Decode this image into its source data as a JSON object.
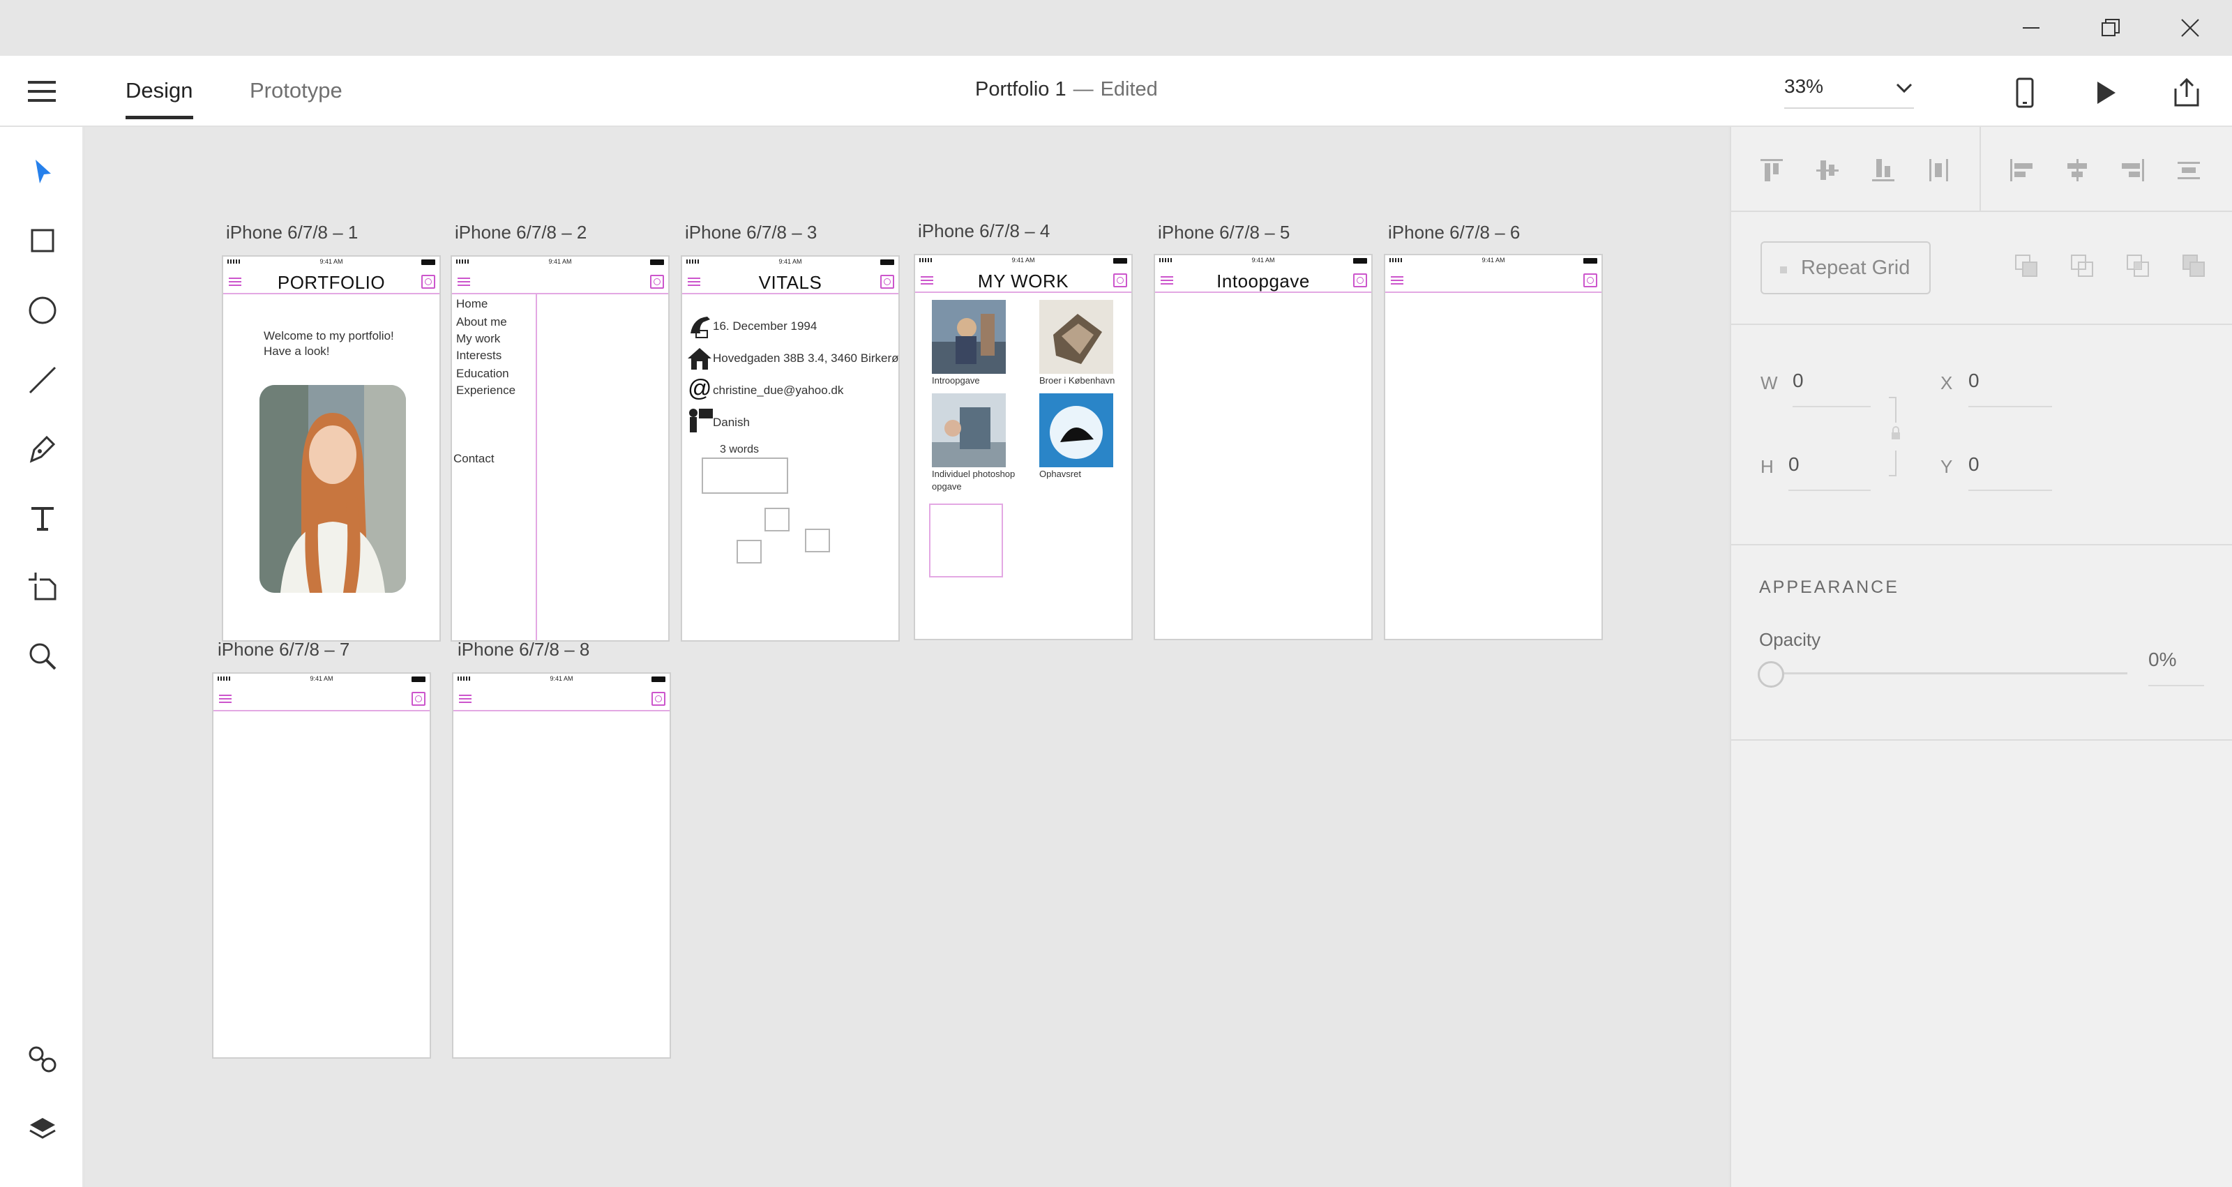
{
  "header": {
    "tabs": [
      "Design",
      "Prototype"
    ],
    "doc_name": "Portfolio 1",
    "doc_separator": "—",
    "doc_status": "Edited",
    "zoom": "33%"
  },
  "tools": [
    "select-icon",
    "rectangle-icon",
    "ellipse-icon",
    "line-icon",
    "pen-icon",
    "text-icon",
    "artboard-icon",
    "zoom-icon",
    "symbols-icon",
    "layers-icon"
  ],
  "artboards": {
    "a1": {
      "label": "iPhone 6/7/8 – 1",
      "title": "PORTFOLIO",
      "welcome1": "Welcome to my portfolio!",
      "welcome2": "Have a look!"
    },
    "a2": {
      "label": "iPhone 6/7/8 – 2",
      "menu": [
        "Home",
        "About me",
        "My work",
        "Interests",
        "Education",
        "Experience"
      ],
      "contact": "Contact"
    },
    "a3": {
      "label": "iPhone 6/7/8 – 3",
      "title": "VITALS",
      "birth": "16. December 1994",
      "address": "Hovedgaden 38B 3.4, 3460 Birkerød",
      "email": "christine_due@yahoo.dk",
      "language": "Danish",
      "words": "3 words"
    },
    "a4": {
      "label": "iPhone 6/7/8 – 4",
      "title": "MY WORK",
      "items": [
        "Introopgave",
        "Broer i København",
        "Individuel photoshop",
        "opgave",
        "Ophavsret"
      ]
    },
    "a5": {
      "label": "iPhone 6/7/8 – 5",
      "title": "Intoopgave"
    },
    "a6": {
      "label": "iPhone 6/7/8 – 6"
    },
    "a7": {
      "label": "iPhone 6/7/8 – 7"
    },
    "a8": {
      "label": "iPhone 6/7/8 – 8"
    },
    "status_time": "9:41 AM",
    "status_battery": "100%"
  },
  "panel": {
    "repeat_grid": "Repeat Grid",
    "w_label": "W",
    "w_value": "0",
    "h_label": "H",
    "h_value": "0",
    "x_label": "X",
    "x_value": "0",
    "y_label": "Y",
    "y_value": "0",
    "appearance": "APPEARANCE",
    "opacity_label": "Opacity",
    "opacity_value": "0%",
    "opacity_level": 0
  },
  "colors": {
    "accent": "#2680eb",
    "wire": "#cc55cc"
  }
}
